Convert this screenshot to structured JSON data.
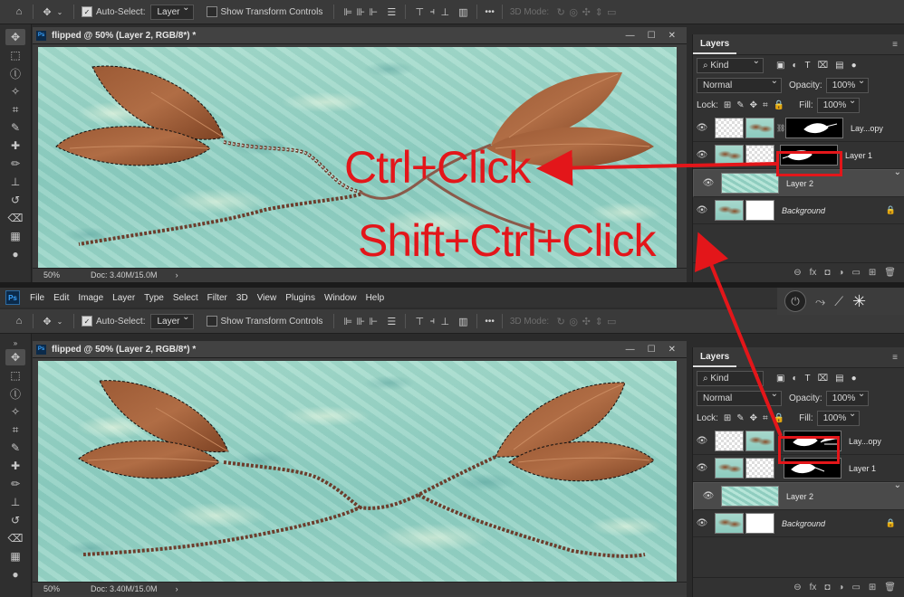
{
  "menu": {
    "items": [
      "File",
      "Edit",
      "Image",
      "Layer",
      "Type",
      "Select",
      "Filter",
      "3D",
      "View",
      "Plugins",
      "Window",
      "Help"
    ]
  },
  "options": {
    "auto_select_label": "Auto-Select:",
    "auto_select_value": "Layer",
    "transform_label": "Show Transform Controls",
    "mode_label": "3D Mode:",
    "more": "•••"
  },
  "document": {
    "title": "flipped @ 50% (Layer 2, RGB/8*) *",
    "zoom": "50%",
    "doc_info": "Doc: 3.40M/15.0M"
  },
  "layers_panel": {
    "tab": "Layers",
    "filter_kind": "Kind",
    "blend_mode": "Normal",
    "opacity_label": "Opacity:",
    "opacity_value": "100%",
    "lock_label": "Lock:",
    "fill_label": "Fill:",
    "fill_value": "100%",
    "layers": [
      {
        "name": "Lay...opy",
        "italic": false
      },
      {
        "name": "Layer 1",
        "italic": false
      },
      {
        "name": "Layer 2",
        "italic": false,
        "selected": true
      },
      {
        "name": "Background",
        "italic": true,
        "locked": true
      }
    ]
  },
  "annotations": {
    "ctrl_click": "Ctrl+Click",
    "shift_ctrl_click": "Shift+Ctrl+Click",
    "color": "#e3161a"
  },
  "colors": {
    "accent": "#e3161a",
    "ui_dark": "#2b2b2b",
    "selected_layer": "#4a4a4a"
  }
}
